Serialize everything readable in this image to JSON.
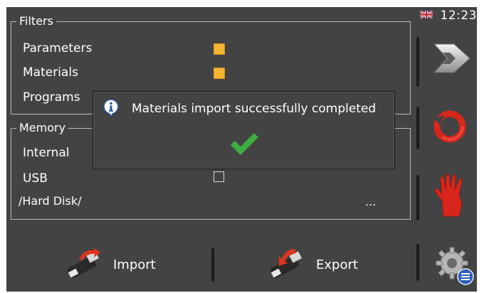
{
  "status": {
    "time": "12:23",
    "language_flag": "uk-flag-icon"
  },
  "filters": {
    "title": "Filters",
    "rows": [
      {
        "label": "Parameters",
        "checked": true
      },
      {
        "label": "Materials",
        "checked": true
      },
      {
        "label": "Programs",
        "checked": true
      }
    ]
  },
  "memory": {
    "title": "Memory",
    "rows": [
      {
        "label": "Internal",
        "checked": false
      },
      {
        "label": "USB",
        "checked": false
      }
    ],
    "path_label": "/Hard Disk/",
    "browse_label": "..."
  },
  "dialog": {
    "message": "Materials import successfully completed",
    "icon": "info-icon",
    "status_icon": "checkmark-icon"
  },
  "actions": {
    "import_label": "Import",
    "export_label": "Export"
  },
  "sidebar": {
    "items": [
      {
        "icon": "forward-arrow-icon"
      },
      {
        "icon": "refresh-circle-icon"
      },
      {
        "icon": "stop-hand-icon"
      },
      {
        "icon": "settings-gear-icon"
      }
    ]
  },
  "colors": {
    "panel_bg": "#434343",
    "checkbox_checked": "#f6b430",
    "success_green": "#3dae43",
    "accent_red": "#d9261c"
  }
}
